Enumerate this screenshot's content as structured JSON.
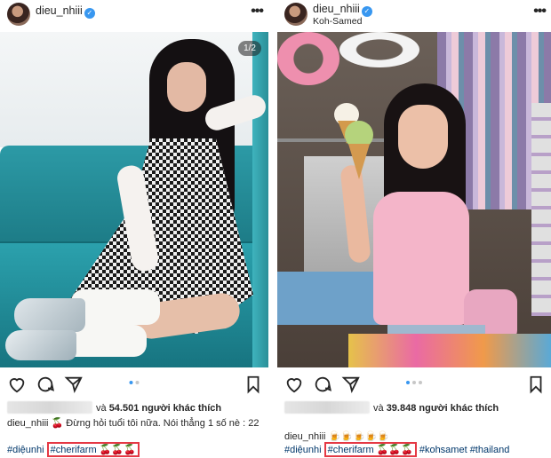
{
  "posts": [
    {
      "username": "dieu_nhiii",
      "location": "",
      "page_indicator": "1/2",
      "likes_prefix": "và",
      "likes_count": "54.501",
      "likes_suffix": "người khác thích",
      "caption_user": "dieu_nhiii",
      "caption_text": "🍒 Đừng hỏi tuổi tôi nữa. Nói thẳng 1 số nè : 22",
      "hashtags_before": "#diệunhi",
      "hashtag_highlight": "#cherifarm 🍒🍒🍒",
      "hashtags_after": ""
    },
    {
      "username": "dieu_nhiii",
      "location": "Koh-Samed",
      "likes_prefix": "và",
      "likes_count": "39.848",
      "likes_suffix": "người khác thích",
      "caption_user": "dieu_nhiii",
      "caption_text": "🍺🍺🍺🍺🍺",
      "hashtags_before": "#diệunhi",
      "hashtag_highlight": "#cherifarm 🍒🍒🍒",
      "hashtags_after": "#kohsamet #thailand"
    }
  ],
  "icons": {
    "verified": "verified-badge-icon",
    "more": "more-options-icon",
    "like": "heart-icon",
    "comment": "comment-icon",
    "share": "send-icon",
    "save": "bookmark-icon"
  },
  "colors": {
    "accent": "#3897f0",
    "hashtag": "#00376b",
    "highlight_border": "#e53945"
  },
  "carousel": {
    "left": {
      "total": 2,
      "active": 0
    },
    "right": {
      "total": 3,
      "active": 0
    }
  }
}
